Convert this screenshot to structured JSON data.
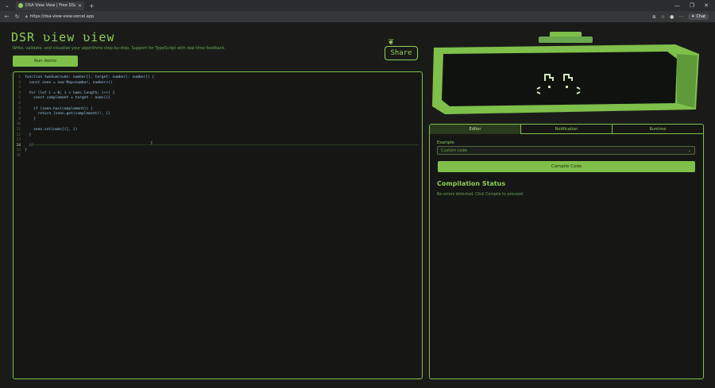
{
  "browser": {
    "tab_title": "DSA View View | Free DSA Study",
    "url": "https://dsa-view-view.vercel.app",
    "chat_label": "Chat"
  },
  "header": {
    "logo": "DSR ʋiew ʋiew",
    "tagline": "Write, validate, and visualize your algorithms step-by-step. Support for TypeScript with real-time feedback.",
    "run_button": "Run demo",
    "share_button": "Share"
  },
  "editor": {
    "lines": [
      {
        "n": "1",
        "text": "function twoSum(nums: number[], target: number): number[] {"
      },
      {
        "n": "2",
        "text": "  const seen = new Map<number, number>()"
      },
      {
        "n": "3",
        "text": ""
      },
      {
        "n": "4",
        "text": "  for (let i = 0; i < nums.length; i++) {"
      },
      {
        "n": "5",
        "text": "    const complement = target - nums[i]"
      },
      {
        "n": "6",
        "text": ""
      },
      {
        "n": "7",
        "text": "    if (seen.has(complement)) {"
      },
      {
        "n": "8",
        "text": "      return [seen.get(complement)!, i]"
      },
      {
        "n": "9",
        "text": "    }"
      },
      {
        "n": "10",
        "text": ""
      },
      {
        "n": "11",
        "text": "    seen.set(nums[i], i)"
      },
      {
        "n": "12",
        "text": "  }"
      },
      {
        "n": "13",
        "text": ""
      },
      {
        "n": "14",
        "text": "  //"
      },
      {
        "n": "15",
        "text": "}"
      },
      {
        "n": "16",
        "text": ""
      }
    ]
  },
  "panel": {
    "tabs": [
      {
        "label": "Editor"
      },
      {
        "label": "Notification"
      },
      {
        "label": "Runtime"
      }
    ],
    "example_label": "Example",
    "example_value": "Custom code",
    "compile_button": "Compile Code",
    "status_title": "Compilation Status",
    "status_text": "No errors detected. Click Compile to proceed."
  },
  "colors": {
    "accent": "#8fce5a",
    "button": "#7fc04a",
    "background": "#1a1b19"
  }
}
